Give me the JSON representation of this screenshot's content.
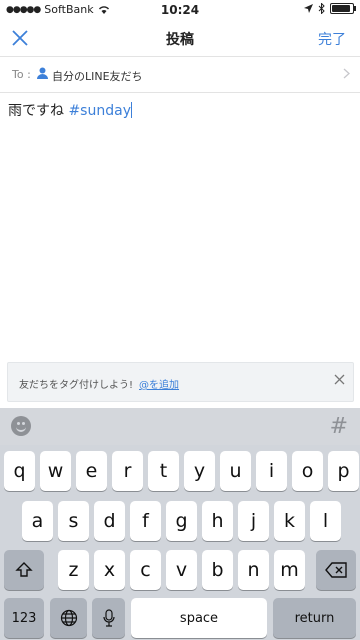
{
  "status_bar": {
    "carrier": "SoftBank",
    "time": "10:24",
    "battery_level": 0.9
  },
  "nav": {
    "title": "投稿",
    "done_label": "完了",
    "close_icon": "close-icon"
  },
  "to_row": {
    "to_label": "To :",
    "target": "自分のLINE友だち"
  },
  "post": {
    "text": "雨ですね ",
    "hashtag": "#sunday"
  },
  "tag_banner": {
    "message": "友だちをタグ付けしよう!",
    "link_label": "@を追加"
  },
  "keyboard": {
    "toolbar_hash": "#",
    "row1": [
      "q",
      "w",
      "e",
      "r",
      "t",
      "y",
      "u",
      "i",
      "o",
      "p"
    ],
    "row2": [
      "a",
      "s",
      "d",
      "f",
      "g",
      "h",
      "j",
      "k",
      "l"
    ],
    "row3": [
      "z",
      "x",
      "c",
      "v",
      "b",
      "n",
      "m"
    ],
    "numbers_label": "123",
    "space_label": "space",
    "return_label": "return"
  },
  "colors": {
    "accent": "#3d80d9",
    "keyboard_bg": "#d1d5db"
  }
}
